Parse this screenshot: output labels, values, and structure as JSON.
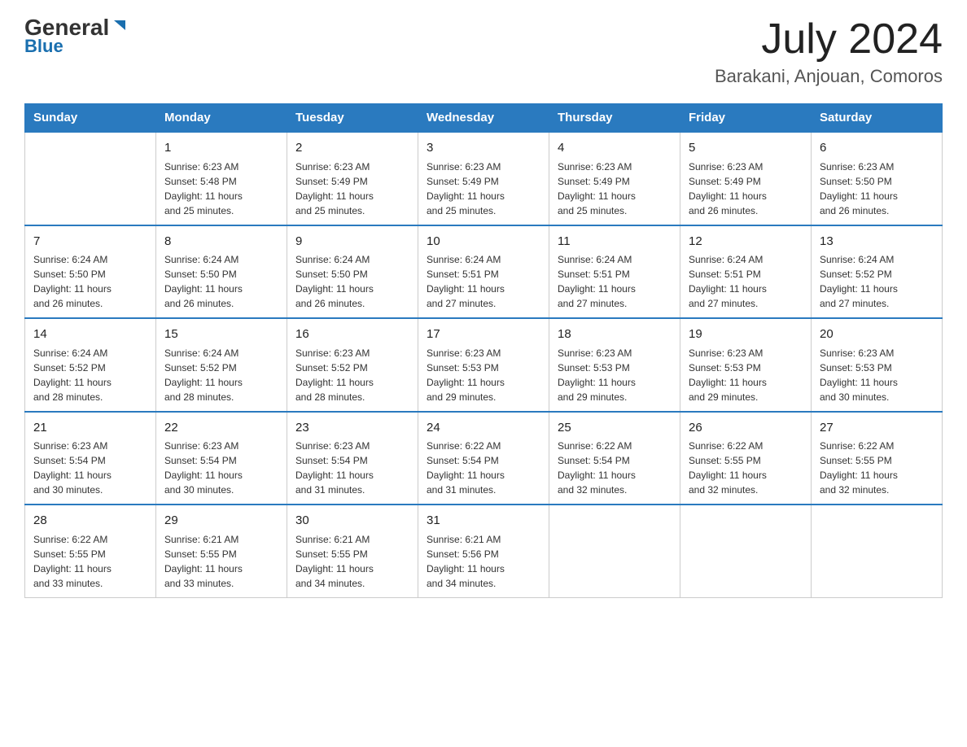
{
  "header": {
    "logo_general": "General",
    "logo_blue": "Blue",
    "month_title": "July 2024",
    "location": "Barakani, Anjouan, Comoros"
  },
  "days_of_week": [
    "Sunday",
    "Monday",
    "Tuesday",
    "Wednesday",
    "Thursday",
    "Friday",
    "Saturday"
  ],
  "weeks": [
    [
      {
        "day": "",
        "info": ""
      },
      {
        "day": "1",
        "info": "Sunrise: 6:23 AM\nSunset: 5:48 PM\nDaylight: 11 hours\nand 25 minutes."
      },
      {
        "day": "2",
        "info": "Sunrise: 6:23 AM\nSunset: 5:49 PM\nDaylight: 11 hours\nand 25 minutes."
      },
      {
        "day": "3",
        "info": "Sunrise: 6:23 AM\nSunset: 5:49 PM\nDaylight: 11 hours\nand 25 minutes."
      },
      {
        "day": "4",
        "info": "Sunrise: 6:23 AM\nSunset: 5:49 PM\nDaylight: 11 hours\nand 25 minutes."
      },
      {
        "day": "5",
        "info": "Sunrise: 6:23 AM\nSunset: 5:49 PM\nDaylight: 11 hours\nand 26 minutes."
      },
      {
        "day": "6",
        "info": "Sunrise: 6:23 AM\nSunset: 5:50 PM\nDaylight: 11 hours\nand 26 minutes."
      }
    ],
    [
      {
        "day": "7",
        "info": "Sunrise: 6:24 AM\nSunset: 5:50 PM\nDaylight: 11 hours\nand 26 minutes."
      },
      {
        "day": "8",
        "info": "Sunrise: 6:24 AM\nSunset: 5:50 PM\nDaylight: 11 hours\nand 26 minutes."
      },
      {
        "day": "9",
        "info": "Sunrise: 6:24 AM\nSunset: 5:50 PM\nDaylight: 11 hours\nand 26 minutes."
      },
      {
        "day": "10",
        "info": "Sunrise: 6:24 AM\nSunset: 5:51 PM\nDaylight: 11 hours\nand 27 minutes."
      },
      {
        "day": "11",
        "info": "Sunrise: 6:24 AM\nSunset: 5:51 PM\nDaylight: 11 hours\nand 27 minutes."
      },
      {
        "day": "12",
        "info": "Sunrise: 6:24 AM\nSunset: 5:51 PM\nDaylight: 11 hours\nand 27 minutes."
      },
      {
        "day": "13",
        "info": "Sunrise: 6:24 AM\nSunset: 5:52 PM\nDaylight: 11 hours\nand 27 minutes."
      }
    ],
    [
      {
        "day": "14",
        "info": "Sunrise: 6:24 AM\nSunset: 5:52 PM\nDaylight: 11 hours\nand 28 minutes."
      },
      {
        "day": "15",
        "info": "Sunrise: 6:24 AM\nSunset: 5:52 PM\nDaylight: 11 hours\nand 28 minutes."
      },
      {
        "day": "16",
        "info": "Sunrise: 6:23 AM\nSunset: 5:52 PM\nDaylight: 11 hours\nand 28 minutes."
      },
      {
        "day": "17",
        "info": "Sunrise: 6:23 AM\nSunset: 5:53 PM\nDaylight: 11 hours\nand 29 minutes."
      },
      {
        "day": "18",
        "info": "Sunrise: 6:23 AM\nSunset: 5:53 PM\nDaylight: 11 hours\nand 29 minutes."
      },
      {
        "day": "19",
        "info": "Sunrise: 6:23 AM\nSunset: 5:53 PM\nDaylight: 11 hours\nand 29 minutes."
      },
      {
        "day": "20",
        "info": "Sunrise: 6:23 AM\nSunset: 5:53 PM\nDaylight: 11 hours\nand 30 minutes."
      }
    ],
    [
      {
        "day": "21",
        "info": "Sunrise: 6:23 AM\nSunset: 5:54 PM\nDaylight: 11 hours\nand 30 minutes."
      },
      {
        "day": "22",
        "info": "Sunrise: 6:23 AM\nSunset: 5:54 PM\nDaylight: 11 hours\nand 30 minutes."
      },
      {
        "day": "23",
        "info": "Sunrise: 6:23 AM\nSunset: 5:54 PM\nDaylight: 11 hours\nand 31 minutes."
      },
      {
        "day": "24",
        "info": "Sunrise: 6:22 AM\nSunset: 5:54 PM\nDaylight: 11 hours\nand 31 minutes."
      },
      {
        "day": "25",
        "info": "Sunrise: 6:22 AM\nSunset: 5:54 PM\nDaylight: 11 hours\nand 32 minutes."
      },
      {
        "day": "26",
        "info": "Sunrise: 6:22 AM\nSunset: 5:55 PM\nDaylight: 11 hours\nand 32 minutes."
      },
      {
        "day": "27",
        "info": "Sunrise: 6:22 AM\nSunset: 5:55 PM\nDaylight: 11 hours\nand 32 minutes."
      }
    ],
    [
      {
        "day": "28",
        "info": "Sunrise: 6:22 AM\nSunset: 5:55 PM\nDaylight: 11 hours\nand 33 minutes."
      },
      {
        "day": "29",
        "info": "Sunrise: 6:21 AM\nSunset: 5:55 PM\nDaylight: 11 hours\nand 33 minutes."
      },
      {
        "day": "30",
        "info": "Sunrise: 6:21 AM\nSunset: 5:55 PM\nDaylight: 11 hours\nand 34 minutes."
      },
      {
        "day": "31",
        "info": "Sunrise: 6:21 AM\nSunset: 5:56 PM\nDaylight: 11 hours\nand 34 minutes."
      },
      {
        "day": "",
        "info": ""
      },
      {
        "day": "",
        "info": ""
      },
      {
        "day": "",
        "info": ""
      }
    ]
  ]
}
